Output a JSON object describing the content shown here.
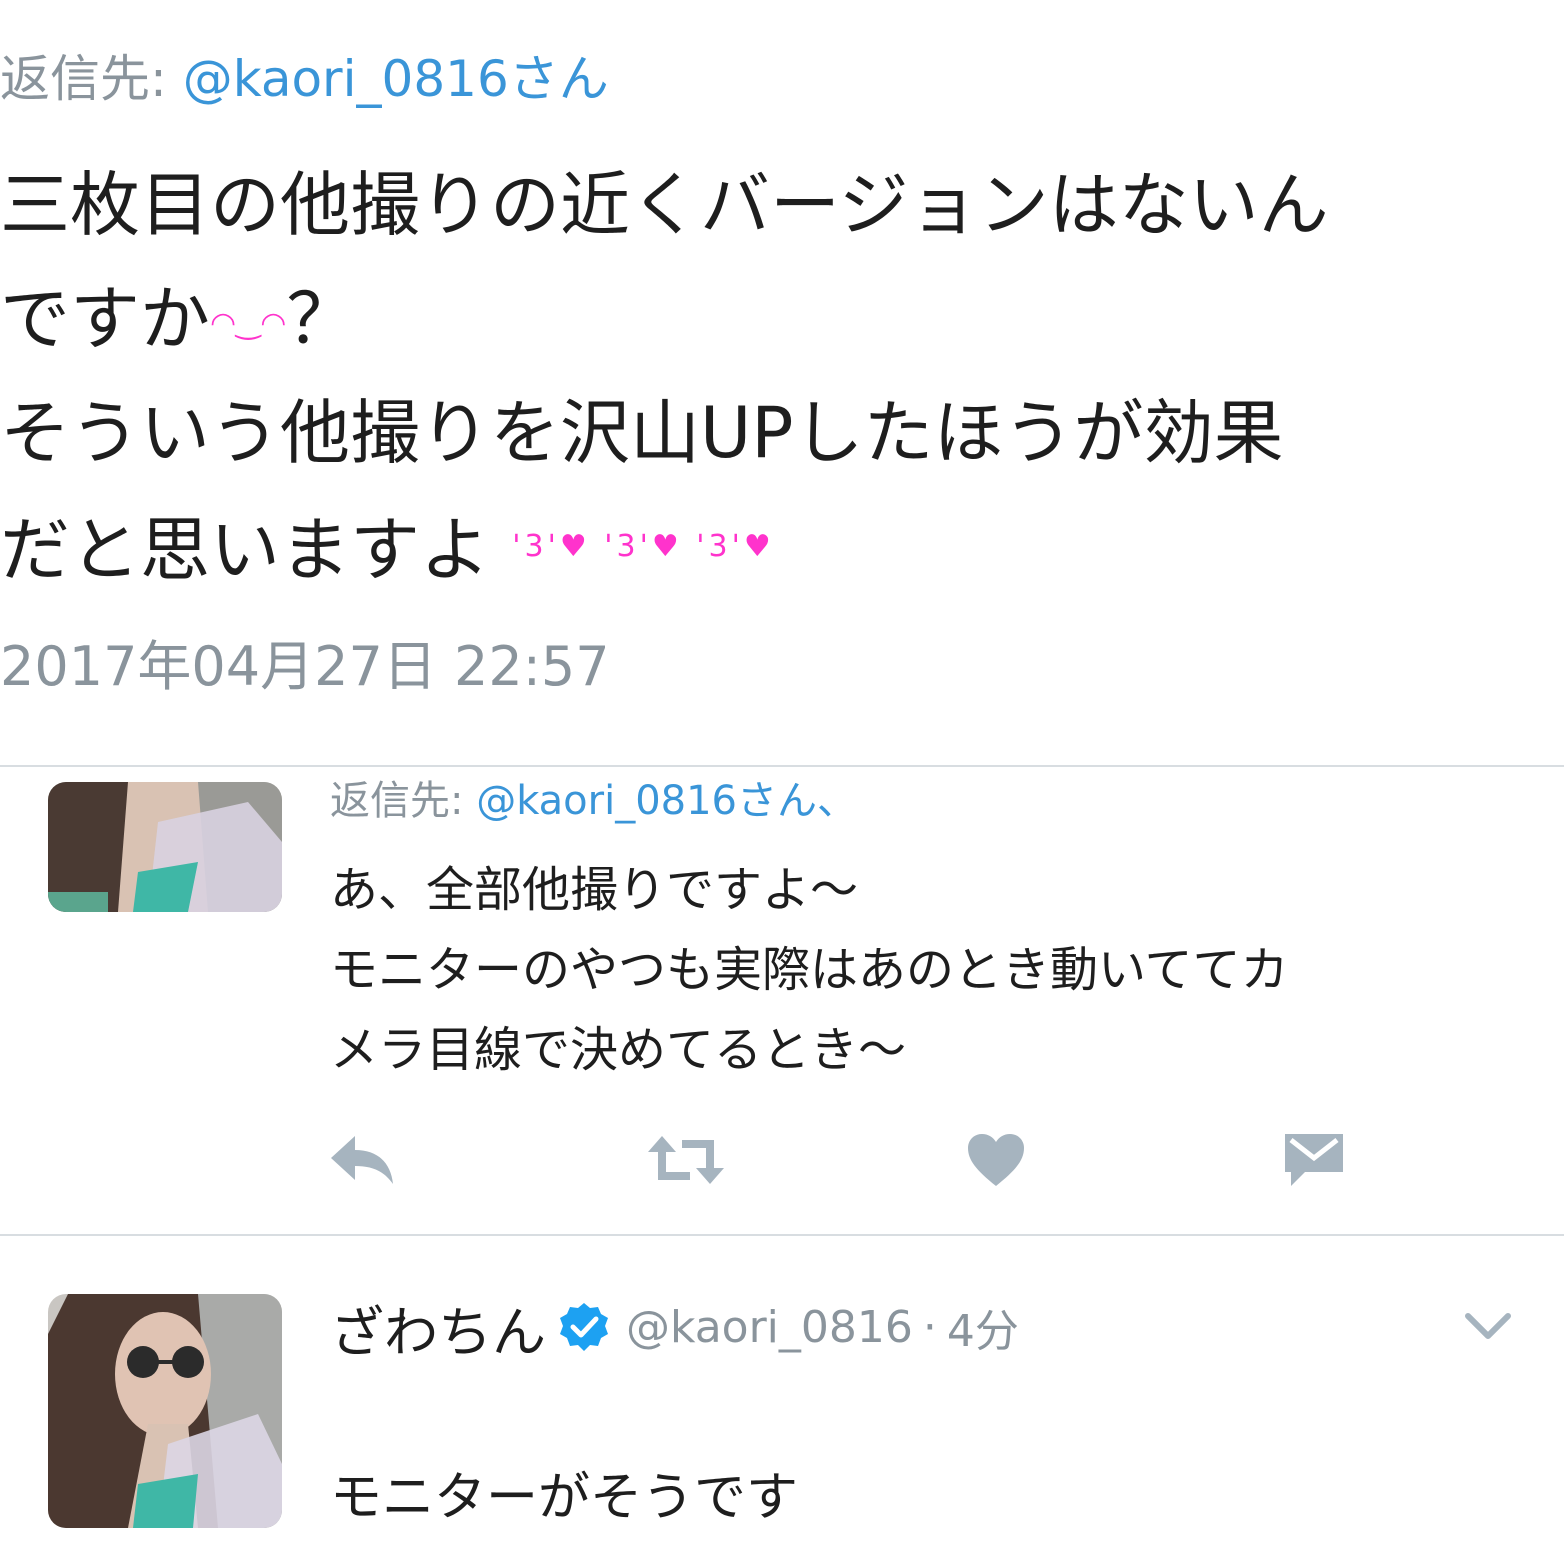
{
  "main_tweet": {
    "reply_prefix": "返信先: ",
    "reply_mention": "@kaori_0816さん",
    "text_lines": [
      "三枚目の他撮りの近くバージョンはないん",
      "ですか",
      "そういう他撮りを沢山UPしたほうが効果",
      "だと思いますよ"
    ],
    "question_mark": "？",
    "kiss_emoji": "'3'♥ '3'♥ '3'♥",
    "smile_emoji": "◠‿◠",
    "timestamp": "2017年04月27日 22:57"
  },
  "reply_1": {
    "reply_prefix": "返信先: ",
    "reply_mention": "@kaori_0816さん、",
    "text_lines": [
      "あ、全部他撮りですよ〜",
      "モニターのやつも実際はあのとき動いててカ",
      "メラ目線で決めてるとき〜"
    ],
    "actions": {
      "reply_icon": "reply-icon",
      "retweet_icon": "retweet-icon",
      "like_icon": "heart-icon",
      "dm_icon": "envelope-icon",
      "icon_color": "#a6b4bf"
    }
  },
  "reply_2": {
    "author_name": "ざわちん",
    "verified": true,
    "handle": "@kaori_0816",
    "separator": "·",
    "time_ago": "4分",
    "text": "モニターがそうです"
  },
  "colors": {
    "mention": "#3a95d8",
    "secondary_text": "#8a949c",
    "verified_badge": "#1da1f2",
    "emoji_pink": "#ff33cc",
    "divider": "#d8dde1"
  }
}
